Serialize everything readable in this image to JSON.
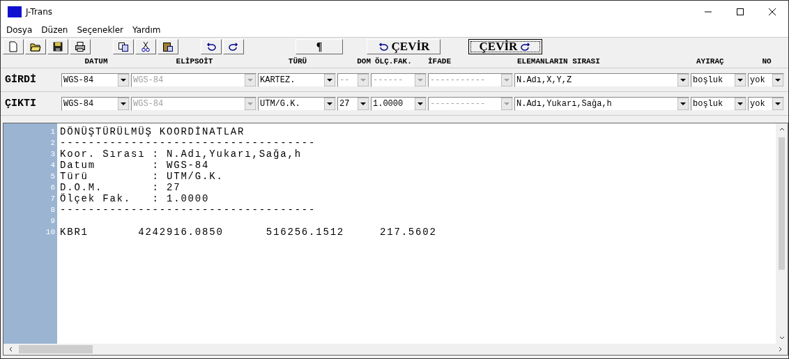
{
  "window": {
    "title": "J-Trans"
  },
  "menu": [
    "Dosya",
    "Düzen",
    "Seçenekler",
    "Yardım"
  ],
  "toolbar": {
    "paragraph_button": "¶",
    "reverse_button": "ÇEVİR",
    "convert_button": "ÇEVİR"
  },
  "columns": [
    "DATUM",
    "ELİPSOİT",
    "TÜRÜ",
    "DOM",
    "ÖLÇ.FAK.",
    "İFADE",
    "ELEMANLARIN SIRASI",
    "AYIRAÇ",
    "NO"
  ],
  "rows": [
    {
      "label": "GİRDİ",
      "fields": [
        {
          "value": "WGS-84",
          "disabled": false
        },
        {
          "value": "WGS-84",
          "disabled": true
        },
        {
          "value": "KARTEZ.",
          "disabled": false
        },
        {
          "value": "--",
          "disabled": true
        },
        {
          "value": "------",
          "disabled": true
        },
        {
          "value": "-----------",
          "disabled": true
        },
        {
          "value": "N.Adı,X,Y,Z",
          "disabled": false
        },
        {
          "value": "boşluk",
          "disabled": false
        },
        {
          "value": "yok",
          "disabled": false
        }
      ]
    },
    {
      "label": "ÇIKTI",
      "fields": [
        {
          "value": "WGS-84",
          "disabled": false
        },
        {
          "value": "WGS-84",
          "disabled": true
        },
        {
          "value": "UTM/G.K.",
          "disabled": false
        },
        {
          "value": "27",
          "disabled": false
        },
        {
          "value": "1.0000",
          "disabled": false
        },
        {
          "value": "-----------",
          "disabled": true
        },
        {
          "value": "N.Adı,Yukarı,Sağa,h",
          "disabled": false
        },
        {
          "value": "boşluk",
          "disabled": false
        },
        {
          "value": "yok",
          "disabled": false
        }
      ]
    }
  ],
  "editor": {
    "lines": [
      {
        "no": "1",
        "text": "DÖNÜŞTÜRÜLMÜŞ KOORDİNATLAR"
      },
      {
        "no": "2",
        "text": "------------------------------------"
      },
      {
        "no": "3",
        "text": "Koor. Sırası : N.Adı,Yukarı,Sağa,h"
      },
      {
        "no": "4",
        "text": "Datum        : WGS-84"
      },
      {
        "no": "5",
        "text": "Türü         : UTM/G.K."
      },
      {
        "no": "6",
        "text": "D.O.M.       : 27"
      },
      {
        "no": "7",
        "text": "Ölçek Fak.   : 1.0000"
      },
      {
        "no": "8",
        "text": "------------------------------------"
      },
      {
        "no": "9"
      },
      {
        "no": "10",
        "text": "KBR1       4242916.0850      516256.1512     217.5602"
      }
    ]
  }
}
